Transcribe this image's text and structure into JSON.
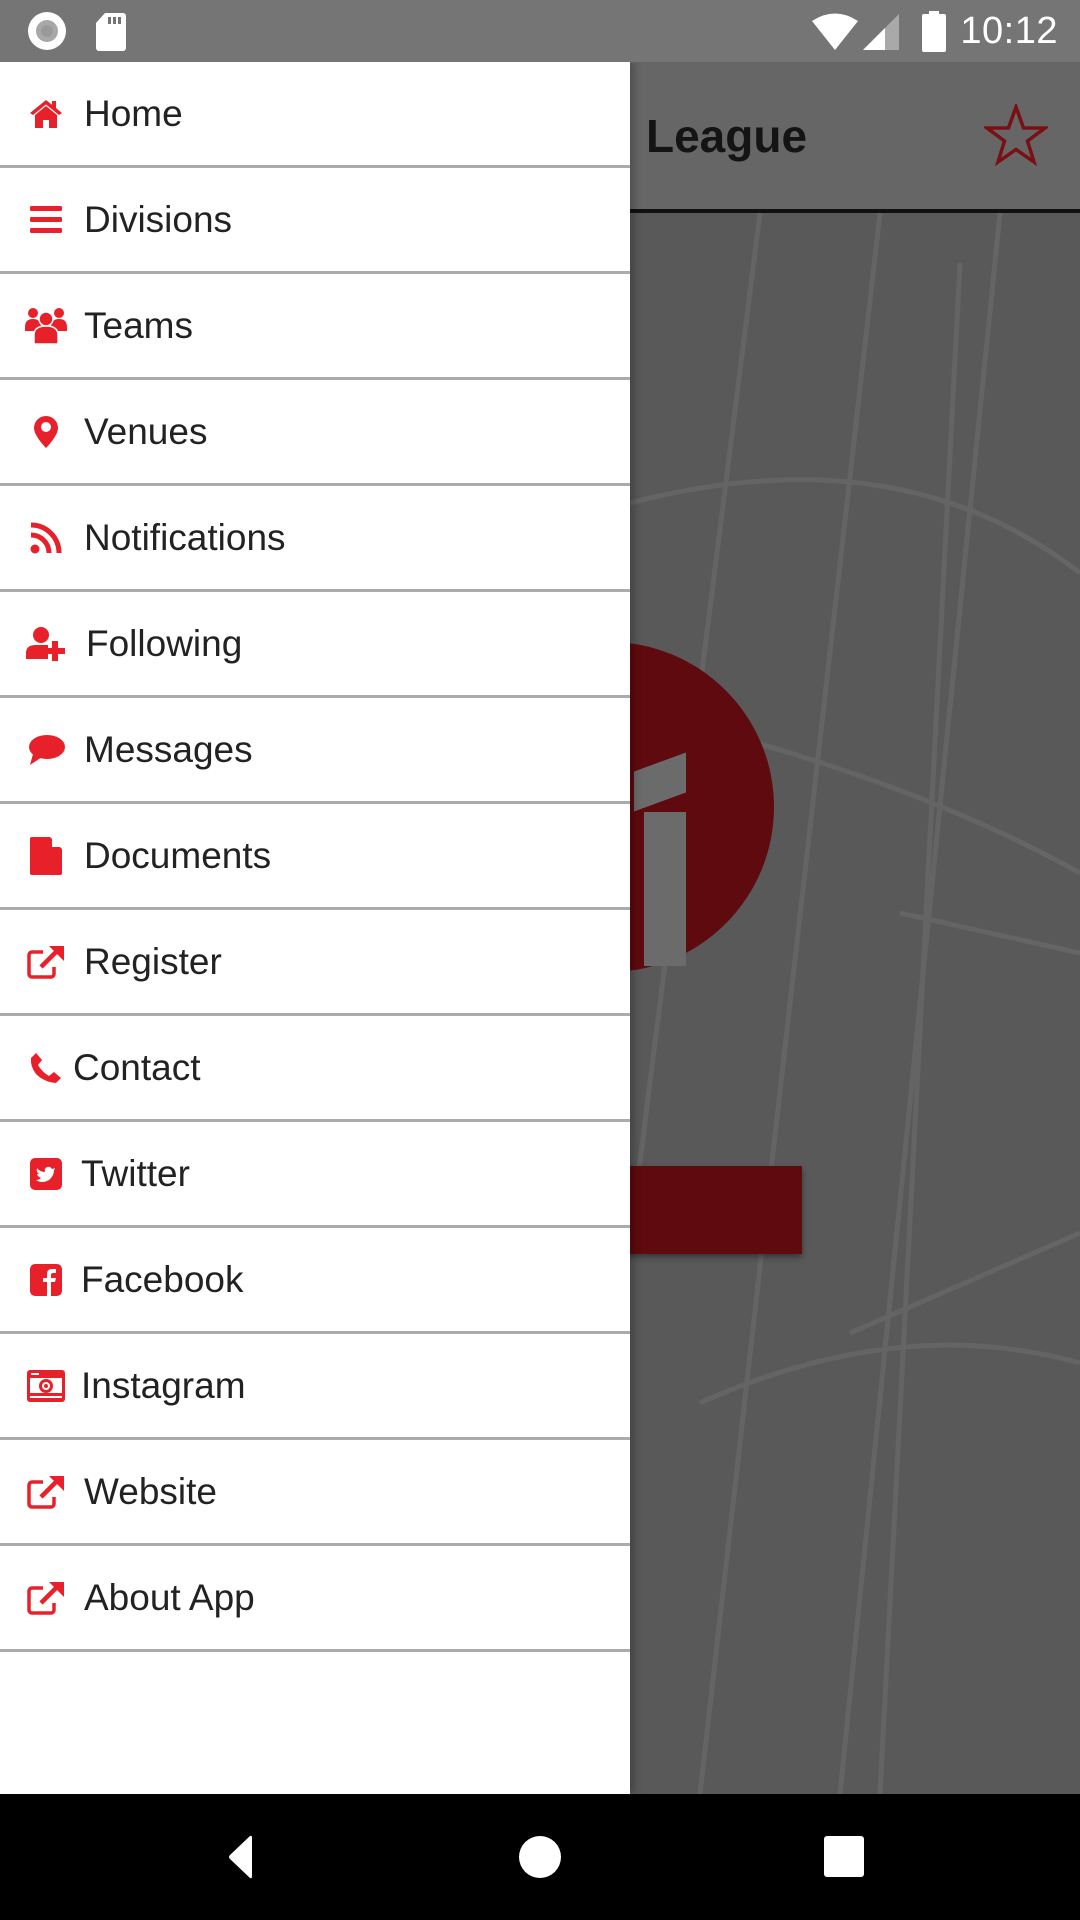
{
  "status_bar": {
    "time": "10:12",
    "left_icons": [
      "record-icon",
      "sd-card-icon"
    ],
    "right_icons": [
      "wifi-icon",
      "signal-icon",
      "battery-icon"
    ]
  },
  "app": {
    "title_partial": "League",
    "favorite_icon": "star-outline-icon",
    "accent_color": "#E8202A",
    "dark_accent_color": "#5E0A0E"
  },
  "drawer": {
    "items": [
      {
        "label": "Home",
        "icon": "home-icon"
      },
      {
        "label": "Divisions",
        "icon": "list-icon"
      },
      {
        "label": "Teams",
        "icon": "users-icon"
      },
      {
        "label": "Venues",
        "icon": "map-marker-icon"
      },
      {
        "label": "Notifications",
        "icon": "rss-icon"
      },
      {
        "label": "Following",
        "icon": "user-plus-icon"
      },
      {
        "label": "Messages",
        "icon": "comment-icon"
      },
      {
        "label": "Documents",
        "icon": "file-icon"
      },
      {
        "label": "Register",
        "icon": "external-link-icon"
      },
      {
        "label": "Contact",
        "icon": "phone-icon"
      },
      {
        "label": "Twitter",
        "icon": "twitter-square-icon"
      },
      {
        "label": "Facebook",
        "icon": "facebook-square-icon"
      },
      {
        "label": "Instagram",
        "icon": "camera-icon"
      },
      {
        "label": "Website",
        "icon": "external-link-icon"
      },
      {
        "label": "About App",
        "icon": "external-link-icon"
      }
    ]
  },
  "nav_bar": {
    "buttons": [
      "back",
      "home",
      "recents"
    ]
  }
}
